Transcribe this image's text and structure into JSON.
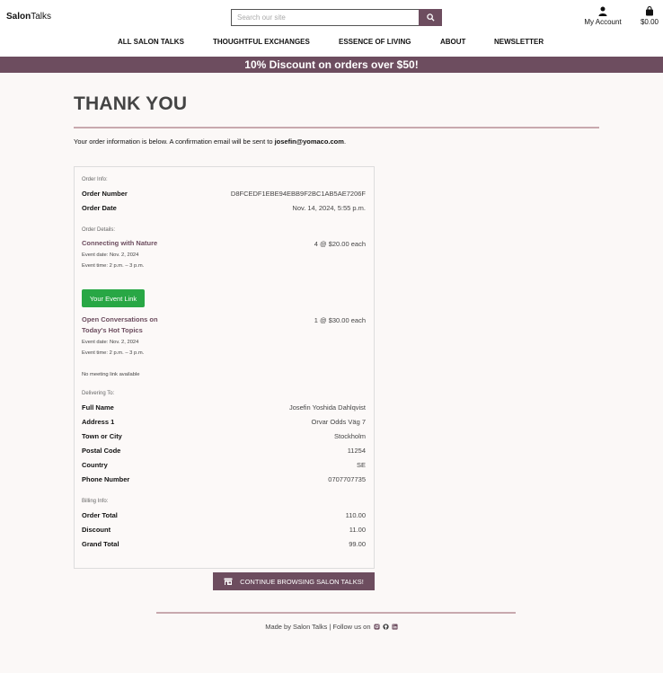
{
  "header": {
    "logo_bold": "Salon",
    "logo_rest": "Talks",
    "search_placeholder": "Search our site",
    "account_label": "My Account",
    "cart_total": "$0.00"
  },
  "nav": [
    "ALL SALON TALKS",
    "THOUGHTFUL EXCHANGES",
    "ESSENCE OF LIVING",
    "ABOUT",
    "NEWSLETTER"
  ],
  "banner": "10% Discount on orders over $50!",
  "page": {
    "title": "THANK YOU",
    "intro_text": "Your order information is below. A confirmation email will be sent to ",
    "intro_email": "josefin@yomaco.com",
    "intro_end": "."
  },
  "order_info": {
    "section": "Order Info:",
    "number_label": "Order Number",
    "number_value": "D8FCEDF1EBE94EBB9F2BC1AB5AE7206F",
    "date_label": "Order Date",
    "date_value": "Nov. 14, 2024, 5:55 p.m."
  },
  "order_details": {
    "section": "Order Details:",
    "items": [
      {
        "title": "Connecting with Nature",
        "qty": "4 @ $20.00 each",
        "event_date": "Event date: Nov. 2, 2024",
        "event_time": "Event time: 2 p.m. – 3 p.m.",
        "link_label": "Your Event Link"
      },
      {
        "title": "Open Conversations on Today's Hot Topics",
        "qty": "1 @ $30.00 each",
        "event_date": "Event date: Nov. 2, 2024",
        "event_time": "Event time: 2 p.m. – 3 p.m.",
        "no_link": "No meeting link available"
      }
    ]
  },
  "delivering": {
    "section": "Delivering To:",
    "rows": [
      {
        "label": "Full Name",
        "value": "Josefin Yoshida Dahlqvist"
      },
      {
        "label": "Address 1",
        "value": "Orvar Odds Väg 7"
      },
      {
        "label": "Town or City",
        "value": "Stockholm"
      },
      {
        "label": "Postal Code",
        "value": "11254"
      },
      {
        "label": "Country",
        "value": "SE"
      },
      {
        "label": "Phone Number",
        "value": "0707707735"
      }
    ]
  },
  "billing": {
    "section": "Billing Info:",
    "rows": [
      {
        "label": "Order Total",
        "value": "110.00"
      },
      {
        "label": "Discount",
        "value": "11.00"
      },
      {
        "label": "Grand Total",
        "value": "99.00"
      }
    ]
  },
  "continue_label": "CONTINUE BROWSING SALON TALKS!",
  "footer_text": "Made by Salon Talks | Follow us on",
  "colors": {
    "brand": "#6d4d5f",
    "accent_green": "#28a745",
    "rule": "#c8a9ae"
  },
  "icons": [
    "search-icon",
    "user-icon",
    "shopping-bag-icon",
    "shop-icon",
    "instagram-icon",
    "github-icon",
    "linkedin-icon"
  ]
}
